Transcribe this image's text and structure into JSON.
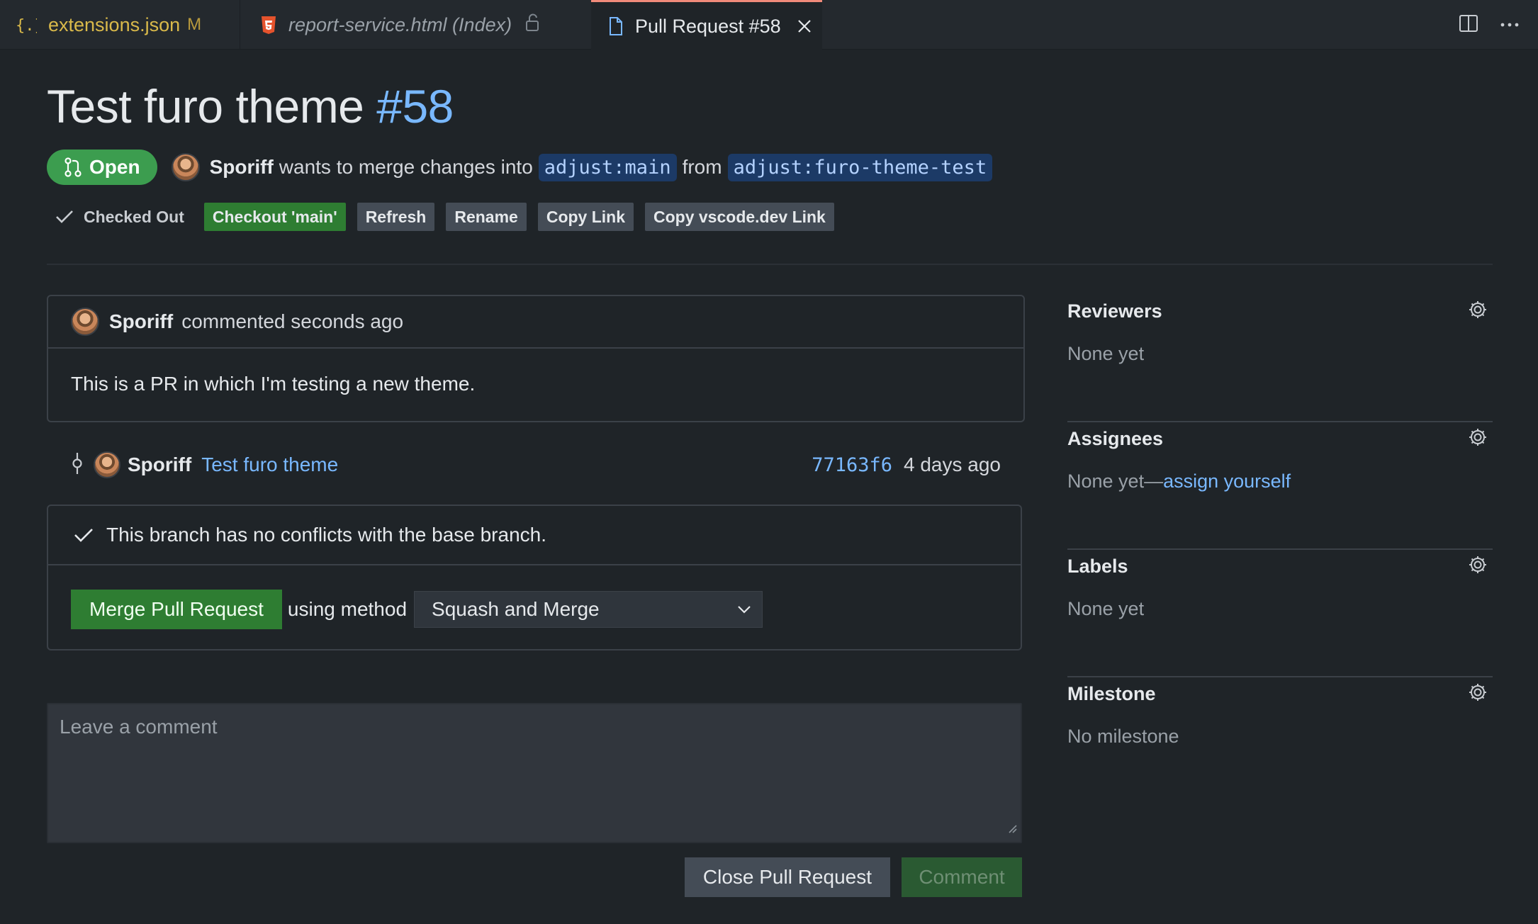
{
  "tabs": [
    {
      "label": "extensions.json",
      "badge": "M",
      "icon": "json-braces-icon"
    },
    {
      "label": "report-service.html (Index)",
      "icon": "html5-icon",
      "locked": true
    },
    {
      "label": "Pull Request #58",
      "icon": "file-icon",
      "active": true
    }
  ],
  "pr": {
    "title": "Test furo theme",
    "number": "#58",
    "status": "Open",
    "author": "Sporiff",
    "merge_text": "wants to merge changes into",
    "base_branch": "adjust:main",
    "from_text": "from",
    "head_branch": "adjust:furo-theme-test"
  },
  "actions": {
    "checked_out": "Checked Out",
    "checkout": "Checkout 'main'",
    "refresh": "Refresh",
    "rename": "Rename",
    "copy_link": "Copy Link",
    "copy_vscode_link": "Copy vscode.dev Link"
  },
  "comment": {
    "author": "Sporiff",
    "meta": "commented seconds ago",
    "body": "This is a PR in which I'm testing a new theme."
  },
  "commit": {
    "author": "Sporiff",
    "message": "Test furo theme",
    "sha": "77163f6",
    "when": "4 days ago"
  },
  "merge": {
    "status": "This branch has no conflicts with the base branch.",
    "button": "Merge Pull Request",
    "using_text": "using method",
    "method": "Squash and Merge"
  },
  "new_comment": {
    "placeholder": "Leave a comment",
    "close_button": "Close Pull Request",
    "comment_button": "Comment"
  },
  "sidebar": {
    "reviewers": {
      "title": "Reviewers",
      "value": "None yet"
    },
    "assignees": {
      "title": "Assignees",
      "value": "None yet—",
      "link": "assign yourself"
    },
    "labels": {
      "title": "Labels",
      "value": "None yet"
    },
    "milestone": {
      "title": "Milestone",
      "value": "No milestone"
    }
  },
  "colors": {
    "background": "#1f2428",
    "accent_blue": "#79b8ff",
    "open_green": "#3c9d4f",
    "merge_green": "#2e7d32",
    "active_tab_border": "#f08a7a"
  }
}
